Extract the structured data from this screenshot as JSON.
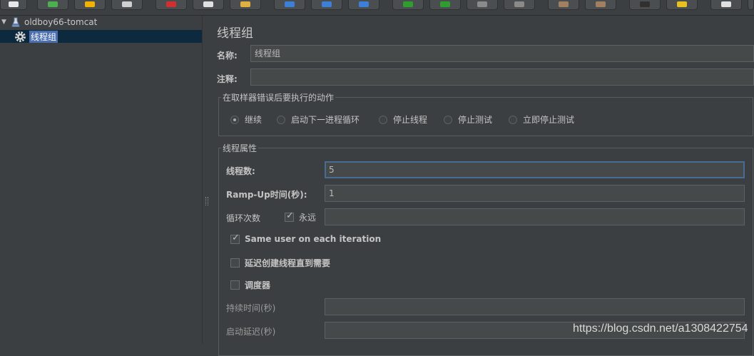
{
  "toolbar": {
    "buttons": [
      {
        "name": "new-icon",
        "color": "#e8e8e8"
      },
      {
        "name": "templates-icon",
        "color": "#4caf50"
      },
      {
        "name": "open-icon",
        "color": "#f0b400"
      },
      {
        "name": "save-icon",
        "color": "#cfcfcf"
      },
      {
        "name": "cut-icon",
        "color": "#d03030"
      },
      {
        "name": "copy-icon",
        "color": "#e0e0e0"
      },
      {
        "name": "paste-icon",
        "color": "#e0b040"
      },
      {
        "name": "expand-icon",
        "color": "#3d7fd6"
      },
      {
        "name": "collapse-icon",
        "color": "#3d7fd6"
      },
      {
        "name": "toggle-icon",
        "color": "#3d7fd6"
      },
      {
        "name": "start-icon",
        "color": "#2e9e2e"
      },
      {
        "name": "start-no-pauses-icon",
        "color": "#2e9e2e"
      },
      {
        "name": "stop-icon",
        "color": "#8a8a8a"
      },
      {
        "name": "shutdown-icon",
        "color": "#8a8a8a"
      },
      {
        "name": "clear-icon",
        "color": "#a08060"
      },
      {
        "name": "clear-all-icon",
        "color": "#a08060"
      },
      {
        "name": "search-icon",
        "color": "#303030"
      },
      {
        "name": "reset-search-icon",
        "color": "#e8c020"
      },
      {
        "name": "function-helper-icon",
        "color": "#e0e0e0"
      }
    ]
  },
  "tree": {
    "root_label": "oldboy66-tomcat",
    "child_label": "线程组"
  },
  "form": {
    "title": "线程组",
    "name_label": "名称:",
    "name_value": "线程组",
    "comment_label": "注释:",
    "comment_value": "",
    "error_action": {
      "legend": "在取样器错误后要执行的动作",
      "options": [
        "继续",
        "启动下一进程循环",
        "停止线程",
        "停止测试",
        "立即停止测试"
      ],
      "selected": 0
    },
    "thread_props": {
      "legend": "线程属性",
      "threads_label": "线程数:",
      "threads_value": "5",
      "rampup_label": "Ramp-Up时间(秒):",
      "rampup_value": "1",
      "loop_label": "循环次数",
      "forever_label": "永远",
      "forever_checked": true,
      "loop_value": "",
      "same_user_label": "Same user on each iteration",
      "same_user_checked": true,
      "delay_label": "延迟创建线程直到需要",
      "delay_checked": false,
      "scheduler_label": "调度器",
      "scheduler_checked": false,
      "duration_label": "持续时间(秒)",
      "duration_value": "",
      "startup_delay_label": "启动延迟(秒)",
      "startup_delay_value": ""
    }
  },
  "watermark": "https://blog.csdn.net/a1308422754"
}
